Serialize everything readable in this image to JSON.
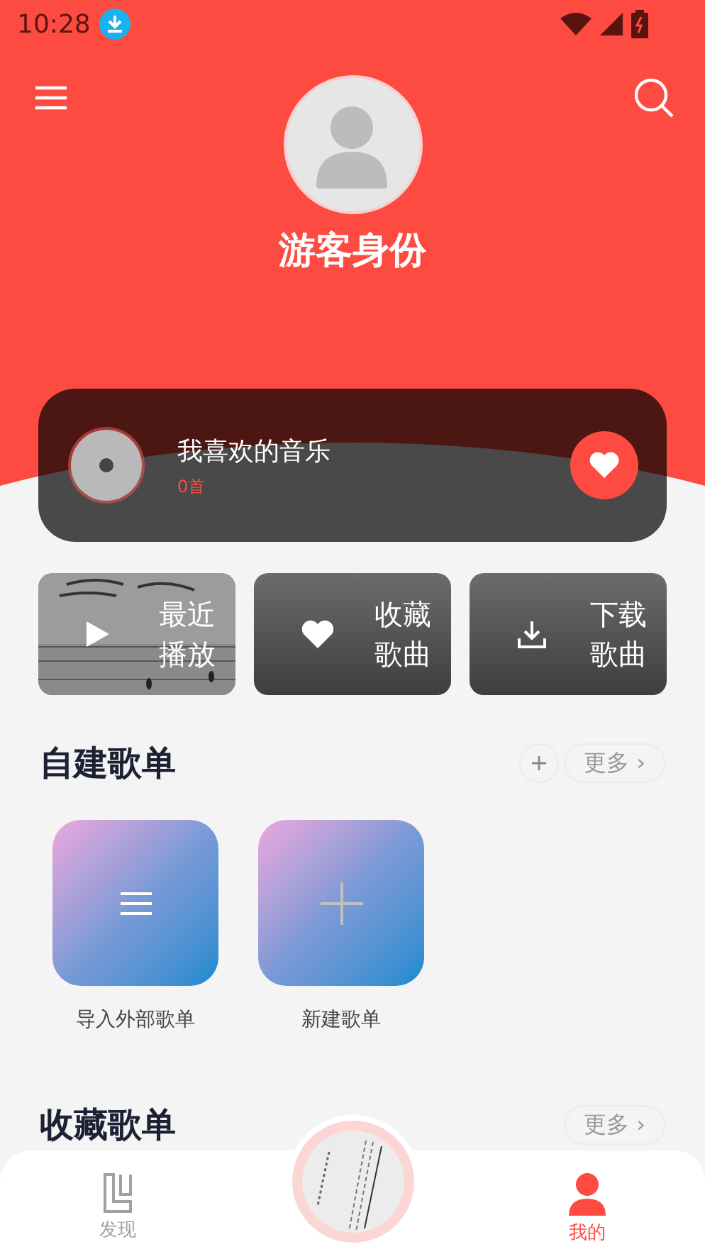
{
  "status_bar": {
    "time": "10:28"
  },
  "profile": {
    "name": "游客身份"
  },
  "favorite": {
    "title": "我喜欢的音乐",
    "count": "0首"
  },
  "quick_actions": [
    {
      "kind": "recent",
      "label": "最近播放"
    },
    {
      "kind": "collect",
      "label": "收藏歌曲"
    },
    {
      "kind": "download",
      "label": "下载歌曲"
    }
  ],
  "created_playlists": {
    "title": "自建歌单",
    "more": "更多 ›",
    "items": [
      {
        "kind": "import",
        "title": "导入外部歌单"
      },
      {
        "kind": "new",
        "title": "新建歌单"
      }
    ]
  },
  "collected_playlists": {
    "title": "收藏歌单",
    "more": "更多 ›"
  },
  "tabs": [
    {
      "kind": "discover",
      "label": "发现",
      "selected": false
    },
    {
      "kind": "mine",
      "label": "我的",
      "selected": true
    }
  ]
}
